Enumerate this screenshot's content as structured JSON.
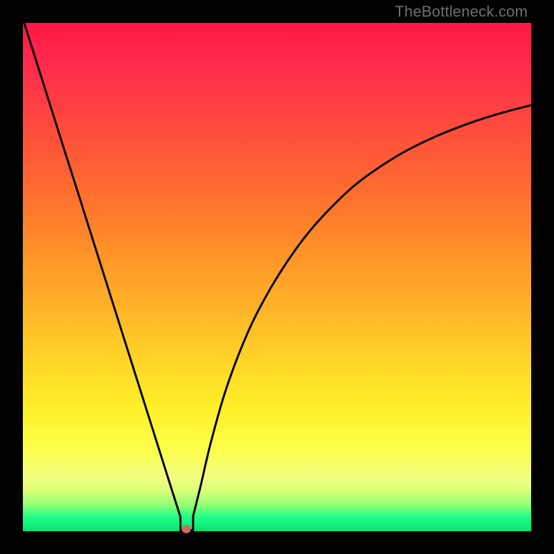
{
  "attribution": "TheBottleneck.com",
  "chart_data": {
    "type": "line",
    "title": "",
    "xlabel": "",
    "ylabel": "",
    "xlim": [
      0,
      100
    ],
    "ylim": [
      0,
      100
    ],
    "grid": false,
    "legend": false,
    "min_point": {
      "x": 32,
      "y": 0
    },
    "series": [
      {
        "name": "left-segment",
        "x": [
          -1.0,
          2.0,
          5.0,
          8.0,
          11.0,
          14.0,
          17.0,
          20.0,
          23.0,
          26.0,
          29.0,
          31.0
        ],
        "values": [
          104.0,
          94.5,
          85.0,
          75.5,
          66.1,
          56.6,
          47.1,
          37.6,
          28.1,
          18.6,
          9.1,
          2.8
        ]
      },
      {
        "name": "right-segment",
        "x": [
          33.5,
          35.0,
          37.0,
          40.0,
          44.0,
          48.0,
          52.0,
          56.0,
          60.0,
          65.0,
          70.0,
          75.0,
          80.0,
          85.0,
          90.0,
          95.0,
          100.0
        ],
        "values": [
          3.0,
          9.0,
          17.5,
          28.0,
          38.5,
          46.5,
          53.0,
          58.5,
          63.0,
          67.8,
          71.5,
          74.6,
          77.1,
          79.2,
          81.0,
          82.5,
          83.8
        ]
      },
      {
        "name": "min-notch",
        "x": [
          31.0,
          31.0,
          33.5,
          33.5
        ],
        "values": [
          2.8,
          0.2,
          0.2,
          3.0
        ]
      }
    ],
    "marker": {
      "x": 32.2,
      "y": 0.4,
      "color": "#d46a5f"
    }
  }
}
